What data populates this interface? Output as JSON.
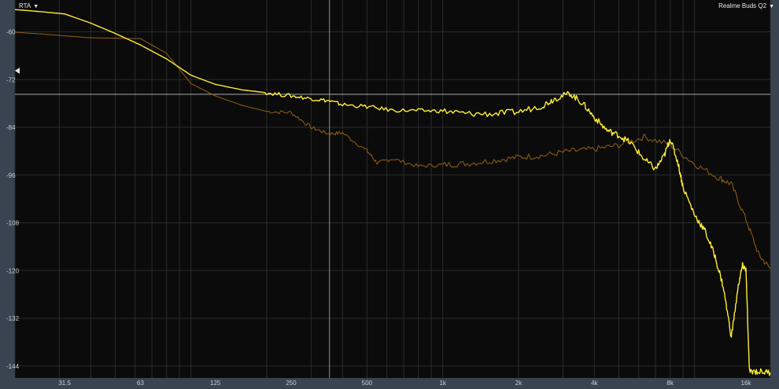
{
  "toolbar": {
    "rta_label": "RTA",
    "device_label": "Realme Buds Q2",
    "caret_icon": "caret-down-icon"
  },
  "colors": {
    "background_outer": "#3a4350",
    "plot_background": "#0b0b0b",
    "grid": "#2b2b2b",
    "series_bright": "#ffee33",
    "series_dim": "#8a5a12",
    "guide_line": "#c8c8c8"
  },
  "chart_data": {
    "type": "line",
    "title": "",
    "xlabel": "",
    "ylabel": "",
    "x_scale": "log",
    "xlim": [
      20,
      20000
    ],
    "ylim": [
      -147,
      -52
    ],
    "x_ticks": [
      31.5,
      63,
      125,
      250,
      500,
      1000,
      2000,
      4000,
      8000,
      16000
    ],
    "x_tick_labels": [
      "31.5",
      "63",
      "125",
      "250",
      "500",
      "1k",
      "2k",
      "4k",
      "8k",
      "16k"
    ],
    "y_ticks": [
      -60,
      -72,
      -84,
      -96,
      -108,
      -120,
      -132,
      -144
    ],
    "y_tick_labels": [
      "-60",
      "-72",
      "-84",
      "-96",
      "-108",
      "-120",
      "-132",
      "-144"
    ],
    "grid": true,
    "reference_level_db": -75.7,
    "cursor_frequency_hz": 355,
    "series": [
      {
        "color": "#ffee33",
        "points": [
          [
            20,
            -54.4
          ],
          [
            25,
            -54.9
          ],
          [
            31.5,
            -55.5
          ],
          [
            40,
            -57.8
          ],
          [
            50,
            -60.4
          ],
          [
            63,
            -63.3
          ],
          [
            80,
            -66.8
          ],
          [
            100,
            -70.9
          ],
          [
            125,
            -73.2
          ],
          [
            160,
            -74.6
          ],
          [
            200,
            -75.3
          ],
          [
            250,
            -76.1
          ],
          [
            300,
            -76.8
          ],
          [
            350,
            -77.3
          ],
          [
            400,
            -78.3
          ],
          [
            500,
            -78.8
          ],
          [
            630,
            -79.7
          ],
          [
            800,
            -79.8
          ],
          [
            1000,
            -79.9
          ],
          [
            1250,
            -80.6
          ],
          [
            1600,
            -80.6
          ],
          [
            2000,
            -80.1
          ],
          [
            2500,
            -78.5
          ],
          [
            2800,
            -76.7
          ],
          [
            3200,
            -75.5
          ],
          [
            3600,
            -78
          ],
          [
            4000,
            -81.5
          ],
          [
            4500,
            -84.8
          ],
          [
            5000,
            -86
          ],
          [
            5600,
            -88
          ],
          [
            6300,
            -92
          ],
          [
            7000,
            -94.5
          ],
          [
            7600,
            -91
          ],
          [
            8000,
            -86.8
          ],
          [
            8600,
            -93
          ],
          [
            9000,
            -99
          ],
          [
            10000,
            -106
          ],
          [
            11000,
            -110
          ],
          [
            12000,
            -116
          ],
          [
            13000,
            -124
          ],
          [
            14000,
            -136.7
          ],
          [
            15000,
            -123
          ],
          [
            15500,
            -118.8
          ],
          [
            16000,
            -119.7
          ],
          [
            16500,
            -145.2
          ],
          [
            18000,
            -145.4
          ],
          [
            20000,
            -145.6
          ]
        ]
      },
      {
        "color": "#8a5a12",
        "points": [
          [
            20,
            -60.1
          ],
          [
            25,
            -60.5
          ],
          [
            31.5,
            -61
          ],
          [
            40,
            -61.5
          ],
          [
            50,
            -61.6
          ],
          [
            63,
            -61.7
          ],
          [
            80,
            -65.4
          ],
          [
            100,
            -73
          ],
          [
            125,
            -76.1
          ],
          [
            160,
            -78.5
          ],
          [
            200,
            -80
          ],
          [
            250,
            -80.3
          ],
          [
            300,
            -84
          ],
          [
            350,
            -85.6
          ],
          [
            400,
            -85.4
          ],
          [
            500,
            -89.9
          ],
          [
            550,
            -93
          ],
          [
            630,
            -91.9
          ],
          [
            800,
            -93.8
          ],
          [
            1000,
            -93.4
          ],
          [
            1250,
            -93.1
          ],
          [
            1600,
            -92.3
          ],
          [
            2000,
            -91.5
          ],
          [
            2500,
            -91.1
          ],
          [
            3200,
            -90
          ],
          [
            4000,
            -89.5
          ],
          [
            5000,
            -88.5
          ],
          [
            6300,
            -86.4
          ],
          [
            8000,
            -88.4
          ],
          [
            10000,
            -93.2
          ],
          [
            12500,
            -96.7
          ],
          [
            14000,
            -98.3
          ],
          [
            16000,
            -107.1
          ],
          [
            18000,
            -116.1
          ],
          [
            20000,
            -119.5
          ]
        ]
      }
    ]
  }
}
